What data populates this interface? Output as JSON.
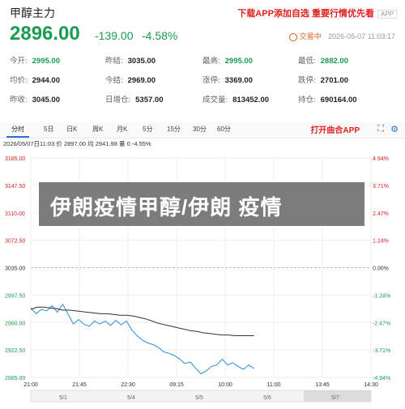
{
  "header": {
    "title": "甲醇主力",
    "promo": "下载APP添加自选 重要行情优先看",
    "app_tag": "APP",
    "price": "2896.00",
    "change": "-139.00",
    "change_pct": "-4.58%",
    "status": "交易中",
    "datetime": "2026-05-07 11:03:17"
  },
  "stats": [
    [
      {
        "k": "今开:",
        "v": "2995.00",
        "green": true
      },
      {
        "k": "昨结:",
        "v": "3035.00"
      },
      {
        "k": "最高:",
        "v": "2995.00",
        "green": true
      },
      {
        "k": "最低:",
        "v": "2882.00",
        "green": true
      }
    ],
    [
      {
        "k": "均价:",
        "v": "2944.00"
      },
      {
        "k": "今结:",
        "v": "2969.00"
      },
      {
        "k": "涨停:",
        "v": "3369.00"
      },
      {
        "k": "跌停:",
        "v": "2701.00"
      }
    ],
    [
      {
        "k": "昨收:",
        "v": "3045.00"
      },
      {
        "k": "日增仓:",
        "v": "5357.00"
      },
      {
        "k": "成交量:",
        "v": "813452.00"
      },
      {
        "k": "持仓:",
        "v": "690164.00"
      }
    ]
  ],
  "tabs": [
    "分时",
    "5日",
    "日K",
    "周K",
    "月K",
    "5分",
    "15分",
    "30分",
    "60分"
  ],
  "active_tab": "分时",
  "open_app": "打开曲合APP",
  "infoline": {
    "time": "2026/05/07日11:03",
    "price_label": "价",
    "price": "2897.00",
    "avg_label": "均",
    "avg": "2941.98",
    "vol_label": "量",
    "vol": "0",
    "pct": "-4.55%"
  },
  "overlay_text": "伊朗疫情甲醇/伊朗 疫情",
  "colors": {
    "up": "#e02020",
    "down": "#1a9c52",
    "accent": "#2a6fd6",
    "price_line": "#2b8fd8",
    "avg_line": "#333333"
  },
  "chart_data": {
    "type": "line",
    "y_ticks": [
      "3185.00",
      "3147.50",
      "3110.00",
      "3072.50",
      "3035.00",
      "2997.50",
      "2960.00",
      "2922.50",
      "2885.00"
    ],
    "pct_ticks": [
      "4.94%",
      "3.71%",
      "2.47%",
      "1.24%",
      "0.00%",
      "-1.24%",
      "-2.47%",
      "-3.71%",
      "-4.94%"
    ],
    "ylim": [
      2885,
      3185
    ],
    "x_ticks": [
      "21:00",
      "21:45",
      "22:30",
      "09:15",
      "10:00",
      "11:00",
      "13:45",
      "14:30"
    ],
    "nav_labels": [
      "5/1",
      "5/4",
      "5/5",
      "5/6",
      "5/7"
    ],
    "series": [
      {
        "values": [
          2980,
          2972,
          2978,
          2976,
          2983,
          2974,
          2985,
          2972,
          2958,
          2964,
          2958,
          2955,
          2962,
          2958,
          2962,
          2956,
          2963,
          2957,
          2962,
          2950,
          2942,
          2936,
          2932,
          2930,
          2926,
          2920,
          2918,
          2915,
          2910,
          2904,
          2906,
          2898,
          2890,
          2894,
          2900,
          2902,
          2910,
          2902,
          2905,
          2900,
          2896,
          2902,
          2897
        ]
      },
      {
        "values": [
          2978,
          2981,
          2981,
          2980,
          2979,
          2977,
          2977,
          2976,
          2975,
          2974,
          2973,
          2972,
          2972,
          2971,
          2970,
          2970,
          2969,
          2967,
          2965,
          2962,
          2959,
          2957,
          2955,
          2953,
          2951,
          2949,
          2948,
          2946,
          2945,
          2944,
          2943,
          2943,
          2942,
          2942,
          2942,
          2942
        ]
      }
    ]
  }
}
